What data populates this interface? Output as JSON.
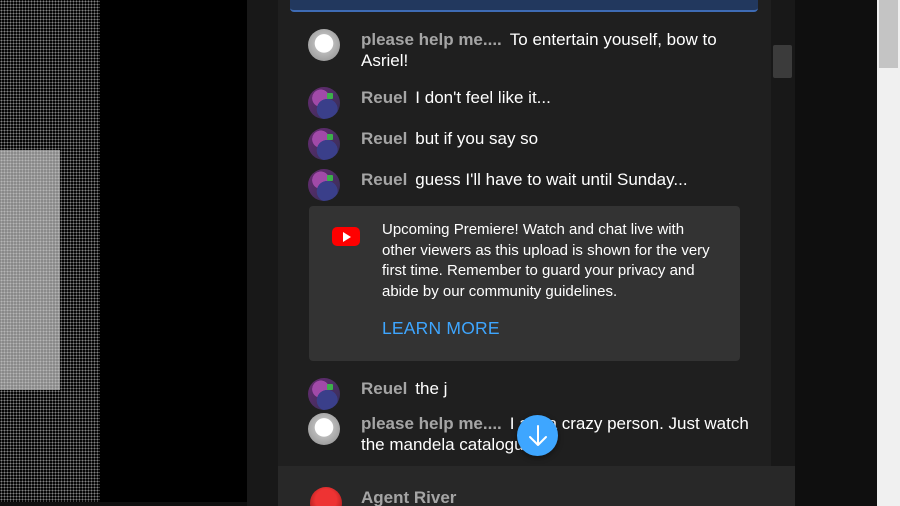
{
  "chat": {
    "messages": [
      {
        "author": "please help me....",
        "text": "To entertain youself, bow to Asriel!",
        "avatar": "white-fluffy-avatar"
      },
      {
        "author": "Reuel",
        "text": "I don't feel like it...",
        "avatar": "pixel-purple-avatar"
      },
      {
        "author": "Reuel",
        "text": "but if you say so",
        "avatar": "pixel-purple-avatar"
      },
      {
        "author": "Reuel",
        "text": "guess I'll have to wait until Sunday...",
        "avatar": "pixel-purple-avatar"
      },
      {
        "author": "Reuel",
        "text": "the j",
        "avatar": "pixel-purple-avatar"
      },
      {
        "author": "please help me....",
        "text": "I am a crazy person. Just watch the mandela catalogue",
        "avatar": "white-fluffy-avatar"
      }
    ],
    "notice": {
      "text": "Upcoming Premiere! Watch and chat live with other viewers as this upload is shown for the very first time. Remember to guard your privacy and abide by our community guidelines.",
      "link": "LEARN MORE",
      "icon": "youtube-icon"
    },
    "footer": {
      "author": "Agent River"
    },
    "scroll_button_icon": "arrow-down-icon"
  },
  "colors": {
    "link": "#3ea6ff",
    "youtube_red": "#ff0000",
    "author": "#a5a5a5",
    "chat_bg": "#1f1f1f",
    "notice_bg": "#333333"
  }
}
